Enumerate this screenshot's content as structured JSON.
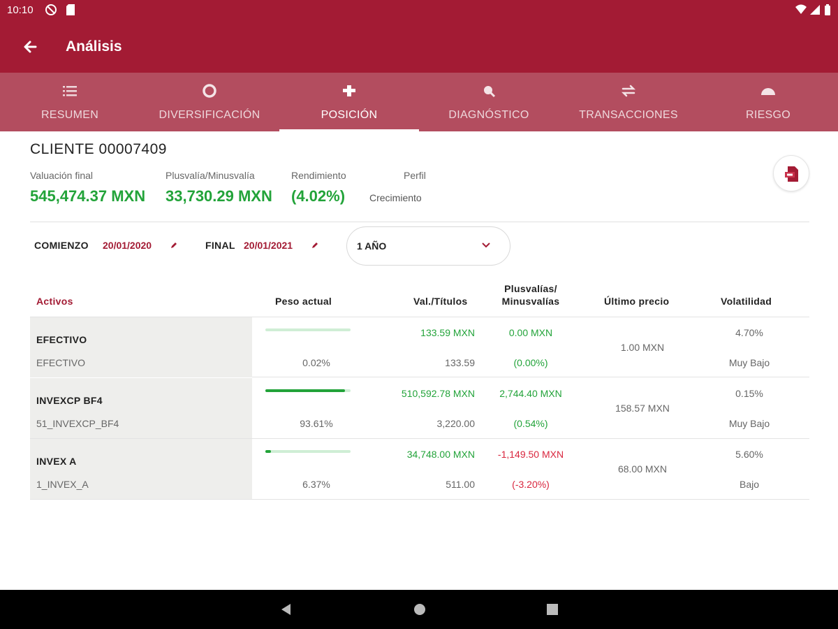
{
  "status_bar": {
    "time": "10:10"
  },
  "app_bar": {
    "title": "Análisis"
  },
  "tabs": [
    {
      "label": "RESUMEN",
      "icon": "list-icon"
    },
    {
      "label": "DIVERSIFICACIÓN",
      "icon": "donut-icon"
    },
    {
      "label": "POSICIÓN",
      "icon": "position-icon",
      "active": true
    },
    {
      "label": "DIAGNÓSTICO",
      "icon": "magnifier-icon"
    },
    {
      "label": "TRANSACCIONES",
      "icon": "swap-icon"
    },
    {
      "label": "RIESGO",
      "icon": "gauge-icon"
    }
  ],
  "client": {
    "title": "CLIENTE 00007409",
    "valuacion_label": "Valuación final",
    "valuacion_value": "545,474.37 MXN",
    "plusvalia_label": "Plusvalía/Minusvalía",
    "plusvalia_value": "33,730.29 MXN",
    "rendimiento_label": "Rendimiento",
    "rendimiento_value": "(4.02%)",
    "perfil_label": "Perfil",
    "perfil_value": "Crecimiento"
  },
  "filters": {
    "comienzo_label": "COMIENZO",
    "comienzo_value": "20/01/2020",
    "final_label": "FINAL",
    "final_value": "20/01/2021",
    "period_value": "1 AÑO"
  },
  "table": {
    "headers": {
      "activos": "Activos",
      "peso": "Peso actual",
      "val": "Val./Títulos",
      "plus_1": "Plusvalías/",
      "plus_2": "Minusvalías",
      "ultimo": "Último precio",
      "volatilidad": "Volatilidad"
    },
    "rows": [
      {
        "name": "EFECTIVO",
        "code": "EFECTIVO",
        "peso": "0.02%",
        "peso_fraction": 0.0002,
        "valor": "133.59 MXN",
        "titulos": "133.59",
        "plusvalia": "0.00 MXN",
        "plusvalia_pct": "(0.00%)",
        "plusvalia_negative": false,
        "ultimo_precio": "1.00 MXN",
        "volatilidad": "4.70%",
        "volatilidad_nivel": "Muy Bajo"
      },
      {
        "name": "INVEXCP BF4",
        "code": "51_INVEXCP_BF4",
        "peso": "93.61%",
        "peso_fraction": 0.9361,
        "valor": "510,592.78 MXN",
        "titulos": "3,220.00",
        "plusvalia": "2,744.40 MXN",
        "plusvalia_pct": "(0.54%)",
        "plusvalia_negative": false,
        "ultimo_precio": "158.57 MXN",
        "volatilidad": "0.15%",
        "volatilidad_nivel": "Muy Bajo"
      },
      {
        "name": "INVEX A",
        "code": "1_INVEX_A",
        "peso": "6.37%",
        "peso_fraction": 0.0637,
        "valor": "34,748.00 MXN",
        "titulos": "511.00",
        "plusvalia": "-1,149.50 MXN",
        "plusvalia_pct": "(-3.20%)",
        "plusvalia_negative": true,
        "ultimo_precio": "68.00 MXN",
        "volatilidad": "5.60%",
        "volatilidad_nivel": "Bajo"
      }
    ]
  },
  "colors": {
    "brand": "#a31b34",
    "tab_bar": "#b34d5f",
    "positive": "#22a339",
    "negative": "#d9263e"
  }
}
